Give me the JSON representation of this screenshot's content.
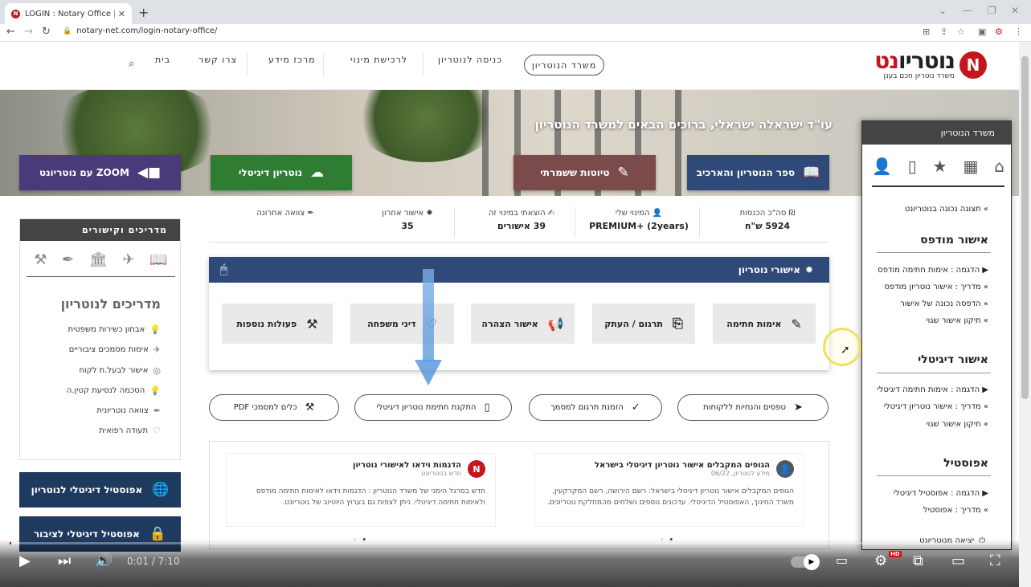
{
  "browser": {
    "tab_title": "LOGIN : Notary Office | נוטריון חכם בענן",
    "tab_favicon": "N",
    "new_tab": "+",
    "url": "notary-net.com/login-notary-office/"
  },
  "header": {
    "logo_main": "נוטריו",
    "logo_accent": "נט",
    "logo_sub": "משרד נוטריון חכם בענן",
    "logo_letter": "N",
    "menu": [
      "בית",
      "צרו קשר",
      "מרכז מידע",
      "לרכישת מינוי",
      "כניסה לנוטריון"
    ],
    "office_button": "משרד הנוטריון"
  },
  "hero": {
    "title": "עו\"ד ישראלה ישראלי, ברוכים הבאים למשרד הנוטריון",
    "buttons": {
      "book": "ספר הנוטריון והארכיב",
      "drafts": "טיוטות ששמרתי",
      "digital": "נוטריון דיגיטלי",
      "zoom": "ZOOM עם נוטריונט"
    }
  },
  "stats": [
    {
      "label": "סה\"כ הכנסות",
      "value": "5924 ש\"ח"
    },
    {
      "label": "המינוי שלי",
      "value": "PREMIUM+ (2years)"
    },
    {
      "label": "הוצאתי במינוי זה",
      "value": "39 אישורים"
    },
    {
      "label": "אישור אחרון",
      "value": "35"
    },
    {
      "label": "צוואה אחרונה",
      "value": ""
    }
  ],
  "approvals": {
    "title": "אישורי נוטריון",
    "tiles": [
      "אימות חתימה",
      "תרגום / העתק",
      "אישור הצהרה",
      "דיני משפחה",
      "פעולות נוספות"
    ]
  },
  "pills": [
    "טפסים והנחיות ללקוחות",
    "הזמנת תרגום למסמך",
    "התקנת חתימת נוטריון דיגיטלי",
    "כלים למסמכי PDF"
  ],
  "news": [
    {
      "title": "הגופים המקבלים אישור נוטריון דיגיטלי בישראל",
      "sub": "מידע לנוטריון, 06/22",
      "body": "הגופים המקבלים אישור נוטריון דיגיטלי בישראל: רשם הירושה, רשם המקרקעין, משרד החינוך, האפוסטיל הדיגיטלי. עדכונים נוספים נשלחים מהמחלקת נוטריונים."
    },
    {
      "title": "הדגמות וידאו לאישורי נוטריון",
      "sub": "חדש בנוטריונט",
      "body": "חדש בסרגל הימני של משרד הנוטריון : הדגמות וידאו לאימות חתימה מודפס ולאימות חתימה דיגיטלי. ניתן לצפות גם בערוץ היוטיוב של נוטריונט."
    }
  ],
  "guides": {
    "header": "מדריכים וקישורים",
    "title": "מדריכים לנוטריון",
    "items": [
      "אבחון כשירות משפטית",
      "אימות מסמכים ציבוריים",
      "אישור לבעל.ת לקוח",
      "הסכמה לנסיעת קטין.ה",
      "צוואה נוטריונית",
      "תעודה רפואית"
    ]
  },
  "apostille_buttons": [
    "אפוסטיל דיגיטלי לנוטריון",
    "אפוסטיל דיגיטלי לציבור"
  ],
  "sidebar": {
    "header": "משרד הנוטריון",
    "proper_display": "תצוגה נכונה בנוטריונט",
    "sections": [
      {
        "title": "אישור מודפס",
        "links": [
          "הדגמה : אימות חתימה מודפס",
          "מדריך : אישור נוטריון מודפס",
          "הדפסה נכונה של אישור",
          "תיקון אישור שגוי"
        ]
      },
      {
        "title": "אישור דיגיטלי",
        "links": [
          "הדגמה : אימות חתימה דיגיטלי",
          "מדריך : אישור נוטריון דיגיטלי",
          "תיקון אישור שגוי"
        ]
      },
      {
        "title": "אפוסטיל",
        "links": [
          "הדגמה : אפוסטיל דיגיטלי",
          "מדריך : אפוסטיל"
        ]
      }
    ],
    "logout": "יציאה מנוטריונט"
  },
  "video": {
    "time": "0:01 / 7:10",
    "progress": 0.002,
    "hd_badge": "HD"
  }
}
